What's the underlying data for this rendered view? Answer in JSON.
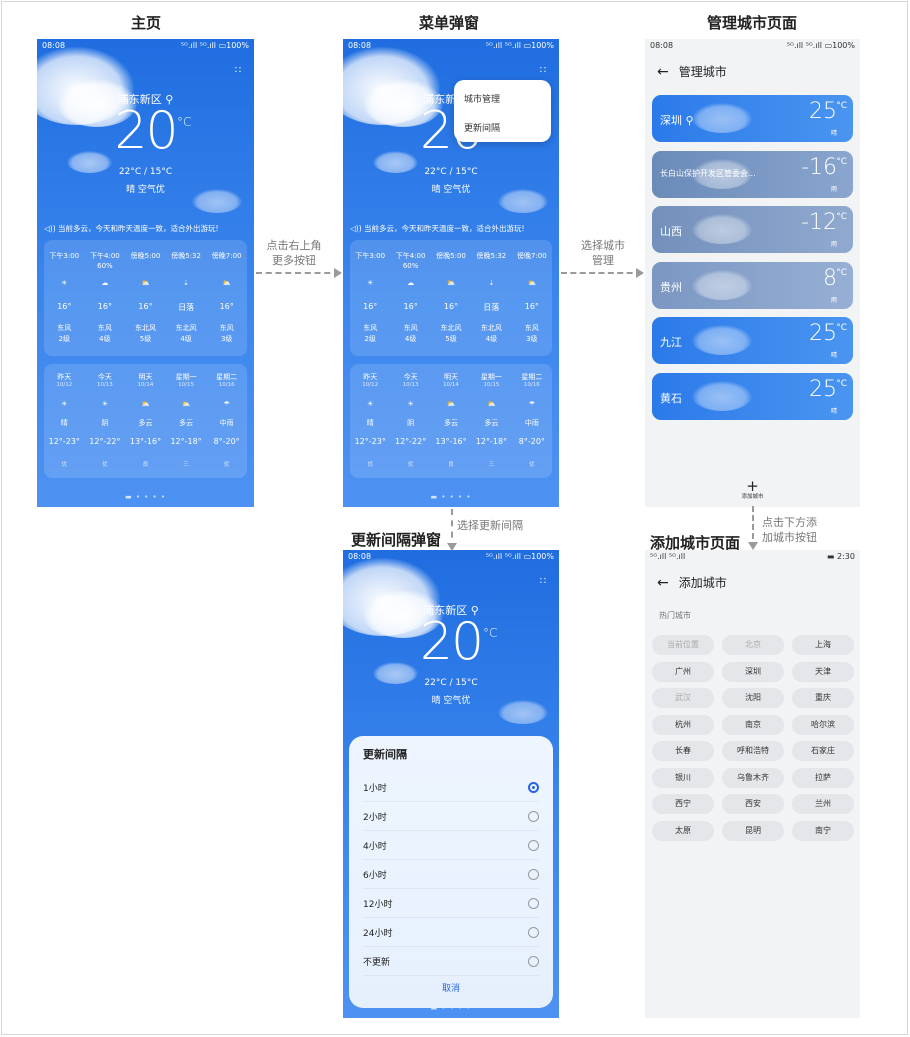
{
  "sections": {
    "home": "主页",
    "menu": "菜单弹窗",
    "manage": "管理城市页面",
    "interval": "更新间隔弹窗",
    "add": "添加城市页面"
  },
  "annotations": {
    "a1": "点击右上角\n更多按钮",
    "a2": "选择城市\n管理",
    "a3": "选择更新间隔",
    "a4": "点击下方添\n加城市按钮"
  },
  "status": {
    "time": "08:08",
    "signal": "⁵ᴳ.ıll ⁵ᴳ.ıll",
    "battery": "▭100%",
    "add_left": "⁵ᴳ.ıll ⁵ᴳ.ıll",
    "add_time": "▬ 2:30"
  },
  "weather": {
    "city": "浦东新区",
    "temp": "20",
    "unit": "°C",
    "range": "22°C / 15°C",
    "cond": "晴 空气优",
    "notice": "◁)) 当前多云，今天和昨天温度一致，适合外出游玩!",
    "hourly": [
      {
        "t": "下午3:00",
        "p": "",
        "icon": "☀",
        "v": "16°",
        "w": "东风\n2级"
      },
      {
        "t": "下午4:00",
        "p": "60%",
        "icon": "☁",
        "v": "16°",
        "w": "东风\n4级"
      },
      {
        "t": "傍晚5:00",
        "p": "",
        "icon": "⛅",
        "v": "16°",
        "w": "东北风\n5级"
      },
      {
        "t": "傍晚5:32",
        "p": "",
        "icon": "⇣",
        "v": "日落",
        "w": "东北风\n4级"
      },
      {
        "t": "傍晚7:00",
        "p": "",
        "icon": "⛅",
        "v": "16°",
        "w": "东风\n3级"
      }
    ],
    "daily": [
      {
        "d": "昨天",
        "dt": "10/12",
        "icon": "☀",
        "c": "晴",
        "r": "12°-23°",
        "a": "优"
      },
      {
        "d": "今天",
        "dt": "10/13",
        "icon": "☀",
        "c": "阴",
        "r": "12°-22°",
        "a": "优"
      },
      {
        "d": "明天",
        "dt": "10/14",
        "icon": "⛅",
        "c": "多云",
        "r": "13°-16°",
        "a": "良"
      },
      {
        "d": "星期一",
        "dt": "10/15",
        "icon": "⛅",
        "c": "多云",
        "r": "12°-18°",
        "a": "三"
      },
      {
        "d": "星期二",
        "dt": "10/16",
        "icon": "☂",
        "c": "中雨",
        "r": "8°-20°",
        "a": "优"
      }
    ],
    "pager": "▬ • • • •"
  },
  "menu": {
    "items": [
      "城市管理",
      "更新间隔"
    ]
  },
  "manage": {
    "title": "管理城市",
    "back": "←",
    "add_label": "添加城市",
    "add_icon": "+",
    "cities": [
      {
        "name": "深圳",
        "temp": "25",
        "desc": "晴",
        "pin": true
      },
      {
        "name": "长白山保护开发区管委会...",
        "temp": "-16",
        "desc": "雨"
      },
      {
        "name": "山西",
        "temp": "-12",
        "desc": "雨"
      },
      {
        "name": "贵州",
        "temp": "8",
        "desc": "雨"
      },
      {
        "name": "九江",
        "temp": "25",
        "desc": "晴"
      },
      {
        "name": "黄石",
        "temp": "25",
        "desc": "晴"
      }
    ]
  },
  "add": {
    "title": "添加城市",
    "back": "←",
    "hot_label": "热门城市",
    "chips": [
      "当前位置",
      "北京",
      "上海",
      "广州",
      "深圳",
      "天津",
      "武汉",
      "沈阳",
      "重庆",
      "杭州",
      "南京",
      "哈尔滨",
      "长春",
      "呼和浩特",
      "石家庄",
      "银川",
      "乌鲁木齐",
      "拉萨",
      "西宁",
      "西安",
      "兰州",
      "太原",
      "昆明",
      "南宁"
    ]
  },
  "interval": {
    "title": "更新间隔",
    "options": [
      "1小时",
      "2小时",
      "4小时",
      "6小时",
      "12小时",
      "24小时",
      "不更新"
    ],
    "selected": 0,
    "cancel": "取消"
  },
  "colors": {
    "sky": "#2f7ce9",
    "accent": "#2a63e0",
    "card_bg": "#f1f3f5"
  }
}
